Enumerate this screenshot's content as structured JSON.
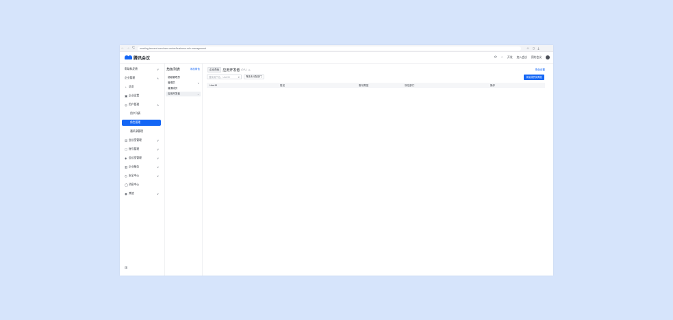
{
  "browser": {
    "url": "meeting.tencent.com/user-center/business-role-management",
    "nav": [
      "←",
      "→",
      "C",
      "☆"
    ],
    "actions": [
      "☆",
      "▯",
      "⤓"
    ]
  },
  "header": {
    "brand": "腾讯会议",
    "links": [
      "开发",
      "加入会议",
      "预约会议"
    ]
  },
  "sidebar": {
    "items": [
      {
        "label": "帮助和反馈",
        "icon": "",
        "chevron": "∨"
      },
      {
        "label": "企业管理",
        "icon": "",
        "chevron": "∧"
      },
      {
        "label": "总览",
        "icon": "◔",
        "chevron": ""
      },
      {
        "label": "企业设置",
        "icon": "▣",
        "chevron": ""
      },
      {
        "label": "用户管理",
        "icon": "◎",
        "chevron": "∧"
      },
      {
        "label": "用户列表",
        "icon": "",
        "chevron": ""
      },
      {
        "label": "角色管理",
        "icon": "",
        "chevron": ""
      },
      {
        "label": "通讯录管理",
        "icon": "",
        "chevron": ""
      },
      {
        "label": "会议室管理",
        "icon": "▤",
        "chevron": "∨"
      },
      {
        "label": "账号管理",
        "icon": "▢",
        "chevron": "∨"
      },
      {
        "label": "会议室管理",
        "icon": "◈",
        "chevron": "∨"
      },
      {
        "label": "企业服务",
        "icon": "▥",
        "chevron": "∨"
      },
      {
        "label": "安全中心",
        "icon": "◷",
        "chevron": "∨"
      },
      {
        "label": "消息中心",
        "icon": "◯",
        "chevron": ""
      },
      {
        "label": "其他",
        "icon": "◉",
        "chevron": "∨"
      }
    ],
    "footer_icon": "⊞"
  },
  "roles": {
    "title": "角色列表",
    "add_label": "添加角色",
    "items": [
      {
        "label": "超级管理员",
        "chevron": ""
      },
      {
        "label": "管理员",
        "chevron": "∨"
      },
      {
        "label": "普通成员",
        "chevron": ""
      },
      {
        "label": "应用开发者",
        "chevron": "⌄"
      }
    ]
  },
  "main": {
    "tag": "企业角色",
    "heading": "应用开发者",
    "count": "(0人)",
    "settings_label": "角色设置",
    "search_placeholder": "搜索用户名、UserID",
    "filter_label": "筛选未分配部门",
    "add_button": "添加成员到角色",
    "columns": [
      "UserID",
      "姓名",
      "账号类型",
      "所在部门",
      "操作"
    ]
  }
}
